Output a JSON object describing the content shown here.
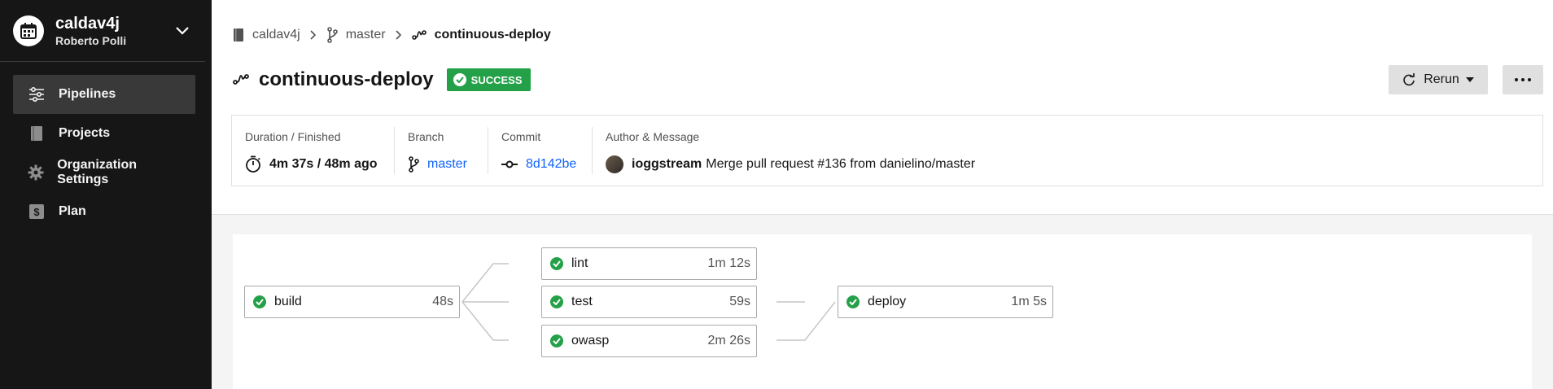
{
  "org": {
    "name": "caldav4j",
    "user": "Roberto Polli"
  },
  "nav": [
    {
      "label": "Pipelines",
      "icon": "pipelines-icon",
      "active": true
    },
    {
      "label": "Projects",
      "icon": "book-icon",
      "active": false
    },
    {
      "label": "Organization Settings",
      "icon": "gear-icon",
      "active": false
    },
    {
      "label": "Plan",
      "icon": "dollar-icon",
      "active": false
    }
  ],
  "breadcrumb": {
    "project": "caldav4j",
    "branch": "master",
    "workflow": "continuous-deploy"
  },
  "header": {
    "title": "continuous-deploy",
    "status": "SUCCESS",
    "rerun_label": "Rerun"
  },
  "info": {
    "duration_label": "Duration / Finished",
    "duration_value": "4m 37s / 48m ago",
    "branch_label": "Branch",
    "branch_value": "master",
    "commit_label": "Commit",
    "commit_value": "8d142be",
    "author_label": "Author & Message",
    "author_name": "ioggstream",
    "commit_message": "Merge pull request #136 from danielino/master"
  },
  "jobs": {
    "build": {
      "name": "build",
      "duration": "48s"
    },
    "lint": {
      "name": "lint",
      "duration": "1m 12s"
    },
    "test": {
      "name": "test",
      "duration": "59s"
    },
    "owasp": {
      "name": "owasp",
      "duration": "2m 26s"
    },
    "deploy": {
      "name": "deploy",
      "duration": "1m 5s"
    }
  },
  "colors": {
    "success": "#24a148",
    "sidebar": "#161616",
    "link": "#0f62fe"
  }
}
